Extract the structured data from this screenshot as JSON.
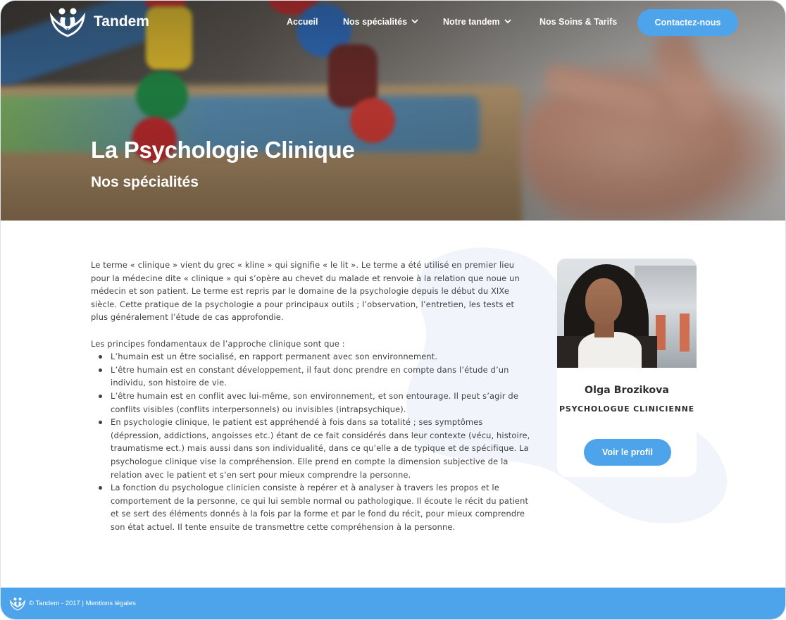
{
  "brand": {
    "name": "Tandem",
    "logo_icon": "tandem-logo-icon"
  },
  "nav": {
    "items": [
      {
        "label": "Accueil",
        "has_dropdown": false
      },
      {
        "label": "Nos spécialités",
        "has_dropdown": true
      },
      {
        "label": "Notre tandem",
        "has_dropdown": true
      },
      {
        "label": "Nos Soins & Tarifs",
        "has_dropdown": false
      }
    ],
    "cta_label": "Contactez-nous",
    "dropdown_icon": "chevron-down-icon"
  },
  "hero": {
    "title": "La Psychologie Clinique",
    "subtitle": "Nos spécialités"
  },
  "article": {
    "intro": "Le terme « clinique » vient du grec « kline » qui signifie « le lit ». Le terme a été utilisé en premier lieu pour la médecine dite « clinique » qui s’opère au chevet du malade et renvoie à la relation que noue un médecin et son patient. Le terme est repris par le domaine de la psychologie depuis le début du XIXe siècle. Cette pratique de la psychologie a pour principaux outils ; l’observation, l’entretien, les tests et plus généralement l’étude de cas approfondie.",
    "principles_lead": "Les principes fondamentaux de l’approche clinique sont que :",
    "principles": [
      "L’humain est un être socialisé, en rapport permanent avec son environnement.",
      "L’être humain est en constant développement, il faut donc prendre en compte dans l’étude d’un individu, son histoire de vie.",
      "L’être humain est en conflit avec lui-même, son environnement, et son entourage. Il peut s’agir de conflits visibles (conflits interpersonnels) ou invisibles (intrapsychique).",
      "En psychologie clinique, le patient est appréhendé à fois dans sa totalité ; ses symptômes (dépression, addictions, angoisses etc.) étant de ce fait considérés dans leur contexte (vécu, histoire, traumatisme ect.) mais aussi dans son individualité, dans ce qu’elle a de typique et de spécifique. La psychologue clinique vise la compréhension. Elle prend en compte la dimension subjective de la relation avec le patient et s’en sert pour mieux comprendre la personne.",
      "La fonction du psychologue clinicien consiste à repérer et à analyser à travers les propos et le comportement de la personne, ce qui lui semble normal ou pathologique. Il écoute le récit du patient et se sert des éléments donnés à la fois par la forme et par le fond du récit, pour mieux comprendre son état actuel. Il tente ensuite de transmettre cette compréhension à la personne."
    ]
  },
  "profile": {
    "name": "Olga Brozikova",
    "role": "PSYCHOLOGUE CLINICIENNE",
    "button_label": "Voir le profil",
    "photo": "portrait-photo"
  },
  "footer": {
    "copyright": "© Tandem - 2017 | ",
    "legal_link": "Mentions légales"
  },
  "colors": {
    "accent": "#4da4ea",
    "text": "#404040",
    "white": "#ffffff"
  }
}
